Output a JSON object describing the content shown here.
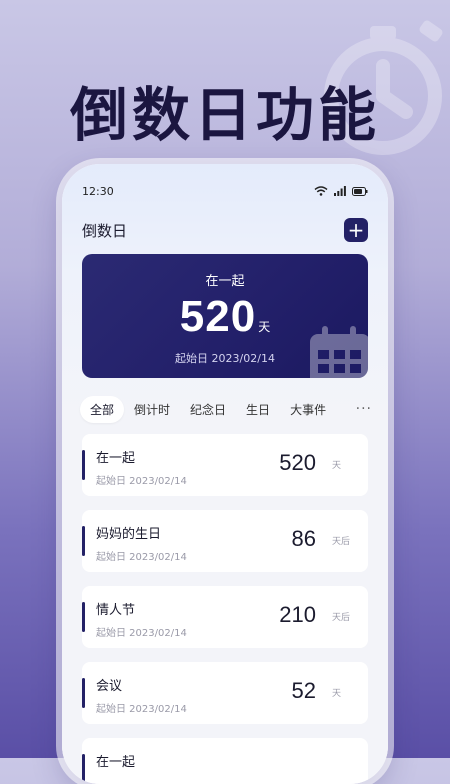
{
  "headline": "倒数日功能",
  "status": {
    "time": "12:30"
  },
  "app": {
    "title": "倒数日",
    "add_label": "+"
  },
  "hero": {
    "title": "在一起",
    "count": "520",
    "unit": "天",
    "date": "起始日 2023/02/14"
  },
  "tabs": [
    "全部",
    "倒计时",
    "纪念日",
    "生日",
    "大事件"
  ],
  "more_label": "···",
  "events": [
    {
      "name": "在一起",
      "date": "起始日 2023/02/14",
      "count": "520",
      "unit": "天"
    },
    {
      "name": "妈妈的生日",
      "date": "起始日 2023/02/14",
      "count": "86",
      "unit": "天后"
    },
    {
      "name": "情人节",
      "date": "起始日 2023/02/14",
      "count": "210",
      "unit": "天后"
    },
    {
      "name": "会议",
      "date": "起始日 2023/02/14",
      "count": "52",
      "unit": "天"
    },
    {
      "name": "在一起",
      "date": "",
      "count": "",
      "unit": ""
    }
  ],
  "colors": {
    "primary": "#232166",
    "hero": "#2b2a73",
    "background": "#7a72bd"
  }
}
